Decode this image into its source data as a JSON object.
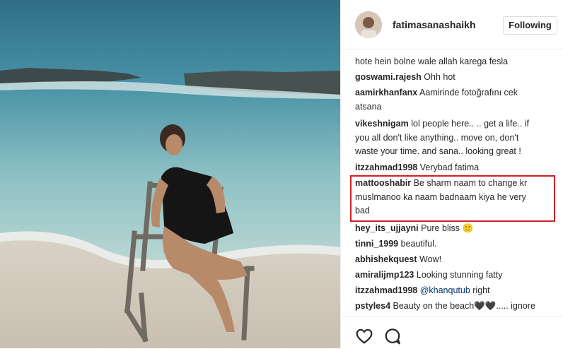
{
  "post": {
    "username": "fatimasanashaikh",
    "follow_label": "Following"
  },
  "comments": [
    {
      "user": "",
      "text": "hote hein bolne wale allah karega fesla"
    },
    {
      "user": "goswami.rajesh",
      "text": "Ohh hot"
    },
    {
      "user": "aamirkhanfanx",
      "text": "Aamirinde fotoğrafını cek",
      "text2": "atsana"
    },
    {
      "user": "vikeshnigam",
      "text": "lol people here.. .. get a life.. if",
      "text2": "you all don't like anything.. move on, don't",
      "text3": "waste your time. and sana.. looking great !"
    },
    {
      "user": "itzzahmad1998",
      "text": "Verybad fatima"
    },
    {
      "user": "mattooshabir",
      "text": "Be sharm naam to change kr",
      "text2": "muslmanoo ka naam badnaam kiya he very",
      "text3": "bad"
    },
    {
      "user": "hey_its_ujjayni",
      "text": "Pure bliss 🙂"
    },
    {
      "user": "tinni_1999",
      "text": "beautiful."
    },
    {
      "user": "abhishekquest",
      "text": "Wow!"
    },
    {
      "user": "amiralijmp123",
      "text": "Looking stunning fatty"
    },
    {
      "user": "itzzahmad1998",
      "mention": "@khanqutub",
      "text": " right"
    },
    {
      "user": "pstyles4",
      "text": "Beauty on the beach🖤🖤..... ignore"
    }
  ],
  "icons": {
    "like": "heart-icon",
    "comment": "comment-icon"
  },
  "colors": {
    "highlight": "#d21f26",
    "mention": "#003569",
    "text": "#262626"
  }
}
